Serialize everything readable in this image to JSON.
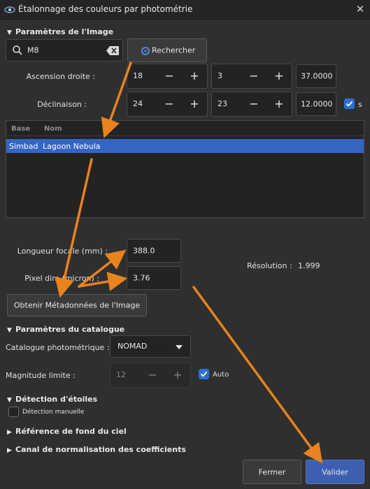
{
  "window": {
    "title": "Étalonnage des couleurs par photométrie",
    "close_glyph": "✕"
  },
  "image_params": {
    "header": "Paramètres de l'Image",
    "search_value": "M8",
    "search_button": "Rechercher",
    "ra_label": "Ascension droite :",
    "ra": {
      "h": "18",
      "m": "3",
      "s": "37.0000"
    },
    "dec_label": "Déclinaison :",
    "dec": {
      "d": "24",
      "m": "23",
      "s": "12.0000"
    },
    "dec_check_label": "s",
    "table": {
      "columns": [
        "Base",
        "Nom"
      ],
      "rows": [
        {
          "base": "Simbad",
          "nom": "Lagoon Nebula"
        }
      ]
    },
    "focal_label": "Longueur focale (mm) :",
    "focal_value": "388.0",
    "pixel_label": "Pixel dim (micron) :",
    "pixel_value": "3.76",
    "resolution_label": "Résolution :",
    "resolution_value": "1.999",
    "metadata_button": "Obtenir Métadonnées de l'Image"
  },
  "catalog": {
    "header": "Paramètres du catalogue",
    "catalog_label": "Catalogue photométrique :",
    "catalog_value": "NOMAD",
    "mag_label": "Magnitude limite :",
    "mag_value": "12",
    "auto_label": "Auto"
  },
  "detection": {
    "header": "Détection d'étoiles",
    "manual_label": "Détection manuelle"
  },
  "sky": {
    "header": "Référence de fond du ciel"
  },
  "norm": {
    "header": "Canal de normalisation des coefficients"
  },
  "footer": {
    "close_button": "Fermer",
    "ok_button": "Valider"
  },
  "colors": {
    "accent": "#2f6fd1",
    "selection": "#3465c5",
    "annotation_arrow": "#e8831e",
    "primary_button": "#3c5fb0"
  },
  "icons": {
    "app": "siril-icon",
    "search": "magnifier-icon",
    "clear": "clear-text-icon",
    "expand": "triangle-down-icon",
    "collapse": "triangle-right-icon",
    "dropdown": "chevron-down-icon",
    "check": "checkmark-icon"
  }
}
